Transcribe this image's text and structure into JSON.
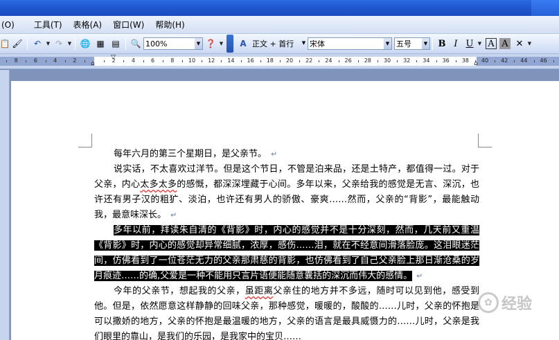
{
  "menu": [
    "(O)",
    "工具(T)",
    "表格(A)",
    "窗口(W)",
    "帮助(H)"
  ],
  "toolbar": {
    "zoom": "100%",
    "style": "正文 + 首行",
    "font": "宋体",
    "size": "五号",
    "bold": "B",
    "italic": "I",
    "underline": "U",
    "char_border": "A",
    "char_shade": "A"
  },
  "ruler": {
    "left_numbers": [
      "8",
      "6",
      "4",
      "2"
    ],
    "right_numbers": [
      "2",
      "4",
      "6",
      "8",
      "10",
      "12",
      "14",
      "16",
      "18",
      "20",
      "22",
      "24",
      "26",
      "28",
      "30",
      "32",
      "34",
      "36",
      "38",
      "40",
      "42",
      "44",
      "46",
      "48"
    ]
  },
  "document": {
    "p1": "每年六月的第三个星期日，是父亲节。",
    "p2a": "说实话，不太喜欢过洋节。但是这个节日，不管是泊来品，还是土特产，都值得一过。对于父亲，内心",
    "p2_squiggle": "太多太多",
    "p2b": "的感慨，都深深埋藏于心间。多年以来，父亲给我的感觉是无言、深沉，也许还有男子汉的粗犷、淡泊，也许还有男人的骄傲、豪爽……然而，父亲的“背影”，最能触动我，最意味深长。",
    "p3": "多年以前，拜读朱自清的《背影》时，内心的感觉并不是十分深刻，然而，几天前又重温《背影》时，内心的感觉却异常细腻，浓厚，感伤……泪，就在不经意间滑落脸庞。这泪眼迷茫间，仿佛看到了一位苍茫无力的父亲那肃慈的背影，也仿佛看到了自己父亲脸上那日渐沧桑的岁月痕迹……的确,父爱是一种不能用只言片语便能随意囊括的深沉而伟大的感情。",
    "p4a": "今年的父亲节，想起我的父亲，",
    "p4_squiggle": "虽距离",
    "p4b": "父亲住的地方并不多远，随时可以见到他，感受到他。但是，依然愿意这样静静的回味父亲，那种感觉，暖暖的，酸酸的……儿时，父亲的怀抱是可以撒娇的地方，父亲的怀抱是最温暖的地方，父亲的语言是最具威慑力的……儿时，父亲是我们眼里的靠山，是我们的乐园，是我家中的宝贝……"
  },
  "watermark": "经验"
}
